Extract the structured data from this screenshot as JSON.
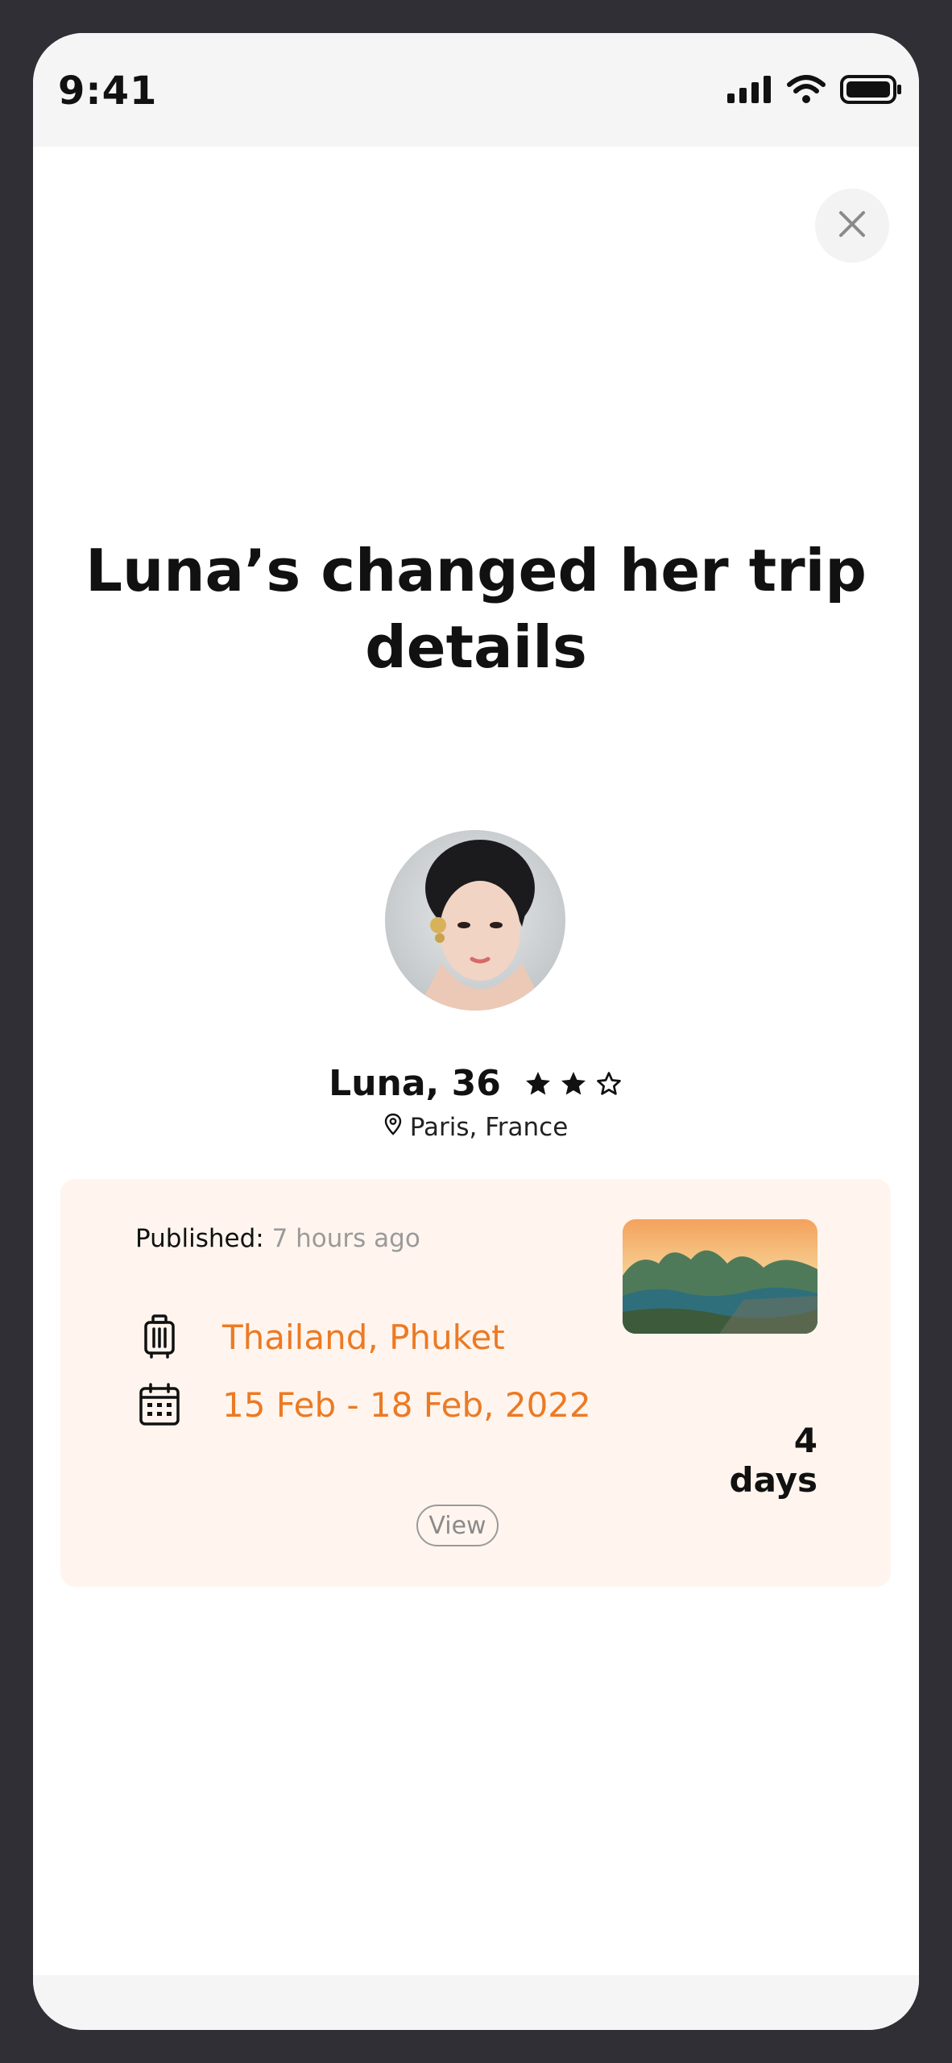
{
  "status_bar": {
    "time": "9:41",
    "icons": [
      "cellular-signal-icon",
      "wifi-icon",
      "battery-icon"
    ]
  },
  "close_button": {
    "icon": "close-icon"
  },
  "title": "Luna’s changed her trip details",
  "profile": {
    "name_age": "Luna, 36",
    "rating": {
      "filled": 2,
      "total": 3
    },
    "location": "Paris, France",
    "location_icon": "map-pin-icon"
  },
  "trip_card": {
    "published_label": "Published:",
    "published_value": "7 hours ago",
    "destination": "Thailand, Phuket",
    "destination_icon": "luggage-icon",
    "dates": "15 Feb - 18 Feb, 2022",
    "dates_icon": "calendar-icon",
    "duration": "4 days",
    "view_label": "View"
  },
  "colors": {
    "accent": "#ec7a24",
    "card_background": "#fff5ee",
    "muted_text": "#9a9a9a",
    "frame": "#2f2f35"
  }
}
